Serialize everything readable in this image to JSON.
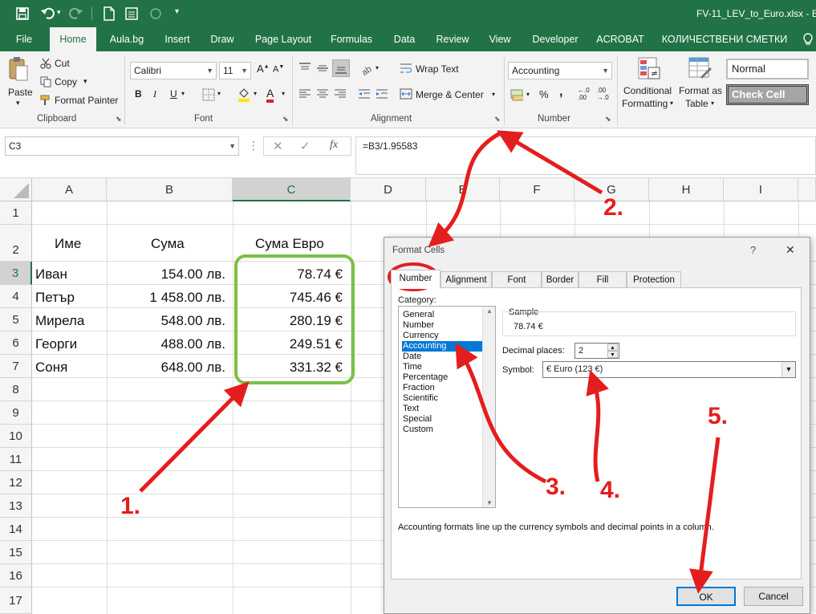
{
  "titlebar": {
    "filename": "FV-11_LEV_to_Euro.xlsx - E"
  },
  "tabs": [
    "File",
    "Home",
    "Aula.bg",
    "Insert",
    "Draw",
    "Page Layout",
    "Formulas",
    "Data",
    "Review",
    "View",
    "Developer",
    "ACROBAT",
    "КОЛИЧЕСТВЕНИ СМЕТКИ"
  ],
  "clipboard": {
    "paste": "Paste",
    "cut": "Cut",
    "copy": "Copy",
    "format_painter": "Format Painter",
    "label": "Clipboard"
  },
  "font": {
    "name": "Calibri",
    "size": "11",
    "bold": "B",
    "italic": "I",
    "underline": "U",
    "color_letter": "A",
    "label": "Font"
  },
  "alignment": {
    "wrap": "Wrap Text",
    "merge": "Merge & Center",
    "label": "Alignment"
  },
  "number": {
    "format": "Accounting",
    "currency": "$",
    "percent": "%",
    "label": "Number"
  },
  "styles": {
    "conditional": "Conditional",
    "formatting": "Formatting",
    "format_as": "Format as",
    "table": "Table",
    "normal": "Normal",
    "check_cell": "Check Cell"
  },
  "formula_bar": {
    "name_box": "C3",
    "cancel": "✕",
    "enter": "✓",
    "fx": "fx",
    "formula": "=B3/1.95583"
  },
  "columns": [
    "A",
    "B",
    "C",
    "D",
    "E",
    "F",
    "G",
    "H",
    "I"
  ],
  "rows": [
    "1",
    "2",
    "3",
    "4",
    "5",
    "6",
    "7",
    "8",
    "9",
    "10",
    "11",
    "12",
    "13",
    "14",
    "15",
    "16",
    "17"
  ],
  "headers": {
    "a2": "Име",
    "b2": "Сума",
    "c2": "Сума Евро"
  },
  "data_rows": [
    {
      "name": "Иван",
      "amount": "154.00 лв.",
      "euro": "78.74 €"
    },
    {
      "name": "Петър",
      "amount": "1 458.00 лв.",
      "euro": "745.46 €"
    },
    {
      "name": "Мирела",
      "amount": "548.00 лв.",
      "euro": "280.19 €"
    },
    {
      "name": "Георги",
      "amount": "488.00 лв.",
      "euro": "249.51 €"
    },
    {
      "name": "Соня",
      "amount": "648.00 лв.",
      "euro": "331.32 €"
    }
  ],
  "dialog": {
    "title": "Format Cells",
    "help": "?",
    "close": "✕",
    "tabs": [
      "Number",
      "Alignment",
      "Font",
      "Border",
      "Fill",
      "Protection"
    ],
    "category_label": "Category:",
    "categories": [
      "General",
      "Number",
      "Currency",
      "Accounting",
      "Date",
      "Time",
      "Percentage",
      "Fraction",
      "Scientific",
      "Text",
      "Special",
      "Custom"
    ],
    "selected_category": "Accounting",
    "sample_label": "Sample",
    "sample_value": "78.74 €",
    "decimal_label": "Decimal places:",
    "decimal_value": "2",
    "symbol_label": "Symbol:",
    "symbol_value": "€ Euro (123 €)",
    "description": "Accounting formats line up the currency symbols and decimal points in a column.",
    "ok": "OK",
    "cancel": "Cancel"
  },
  "annotations": [
    "1.",
    "2.",
    "3.",
    "4.",
    "5."
  ],
  "colors": {
    "excel_green": "#217346",
    "highlight_green": "#7ac143",
    "arrow_red": "#e41e1e",
    "selection_blue": "#0078d7"
  }
}
